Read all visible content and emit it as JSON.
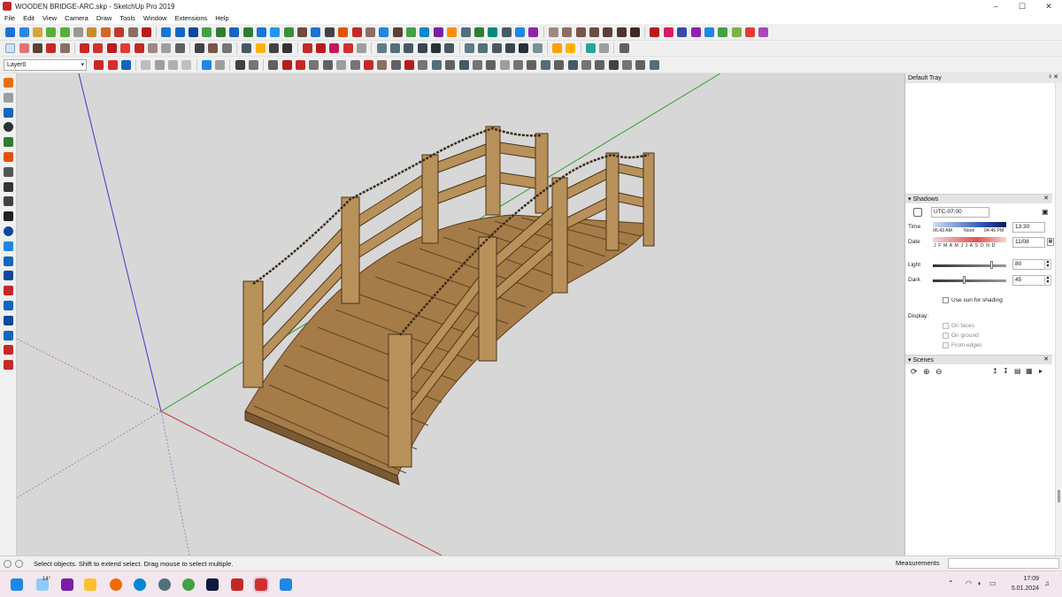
{
  "window": {
    "title": "WOODEN BRIDGE-ARC.skp - SketchUp Pro 2019",
    "controls": [
      "–",
      "☐",
      "✕"
    ]
  },
  "menu": [
    "File",
    "Edit",
    "View",
    "Camera",
    "Draw",
    "Tools",
    "Window",
    "Extensions",
    "Help"
  ],
  "layer": {
    "current": "Layer0"
  },
  "tray": {
    "title": "Default Tray",
    "shadows": {
      "header": "Shadows",
      "timezone": "UTC-07:00",
      "time_label": "Time",
      "time_start": "06:43 AM",
      "time_noon": "Noon",
      "time_end": "04:45 PM",
      "time_value": "13:30",
      "date_label": "Date",
      "months": "J F M A M J J A S O N D",
      "date_value": "11/08",
      "light_label": "Light",
      "light_value": "80",
      "dark_label": "Dark",
      "dark_value": "45",
      "use_sun": "Use sun for shading",
      "display_label": "Display:",
      "on_faces": "On faces",
      "on_ground": "On ground",
      "from_edges": "From edges"
    },
    "scenes": {
      "header": "Scenes"
    }
  },
  "status": {
    "message": "Select objects. Shift to extend select. Drag mouse to select multiple.",
    "measurements_label": "Measurements"
  },
  "taskbar": {
    "weather": "14°",
    "time": "17:09",
    "date": "5.01.2024"
  }
}
